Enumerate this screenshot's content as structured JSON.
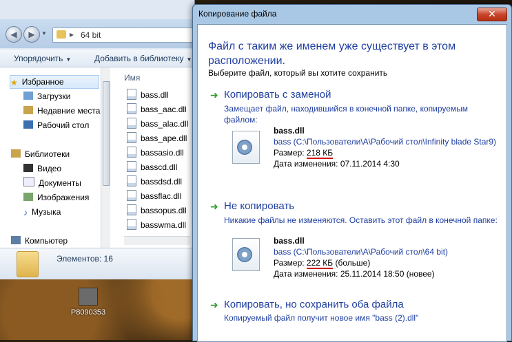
{
  "explorer": {
    "path": "64 bit",
    "toolbar": {
      "organize": "Упорядочить",
      "add_library": "Добавить в библиотеку"
    },
    "nav": {
      "favorites": "Избранное",
      "downloads": "Загрузки",
      "recent": "Недавние места",
      "desktop": "Рабочий стол",
      "libraries": "Библиотеки",
      "video": "Видео",
      "documents": "Документы",
      "pictures": "Изображения",
      "music": "Музыка",
      "computer": "Компьютер"
    },
    "column_name": "Имя",
    "files": [
      "bass.dll",
      "bass_aac.dll",
      "bass_alac.dll",
      "bass_ape.dll",
      "bassasio.dll",
      "basscd.dll",
      "bassdsd.dll",
      "bassflac.dll",
      "bassopus.dll",
      "basswma.dll"
    ],
    "item_count": "Элементов: 16"
  },
  "desktop": {
    "icon_label": "P8090353"
  },
  "dialog": {
    "title": "Копирование файла",
    "close": "✕",
    "heading": "Файл с таким же именем уже существует в этом расположении.",
    "subtext": "Выберите файл, который вы хотите сохранить",
    "option1": {
      "title": "Копировать с заменой",
      "desc": "Замещает файл, находившийся в конечной папке, копируемым файлом:",
      "file_name": "bass.dll",
      "file_path": "bass (C:\\Пользователи\\A\\Рабочий стол\\Infinity blade Star9)",
      "size_label": "Размер: ",
      "size_value": "218 КБ",
      "date": "Дата изменения: 07.11.2014 4:30"
    },
    "option2": {
      "title": "Не копировать",
      "desc": "Никакие файлы не изменяются. Оставить этот файл в конечной папке:",
      "file_name": "bass.dll",
      "file_path": "bass (C:\\Пользователи\\A\\Рабочий стол\\64 bit)",
      "size_label": "Размер: ",
      "size_value": "222 КБ",
      "size_note": " (больше)",
      "date": "Дата изменения: 25.11.2014 18:50 (новее)"
    },
    "option3": {
      "title": "Копировать, но сохранить оба файла",
      "desc": "Копируемый файл получит новое имя \"bass (2).dll\""
    }
  }
}
